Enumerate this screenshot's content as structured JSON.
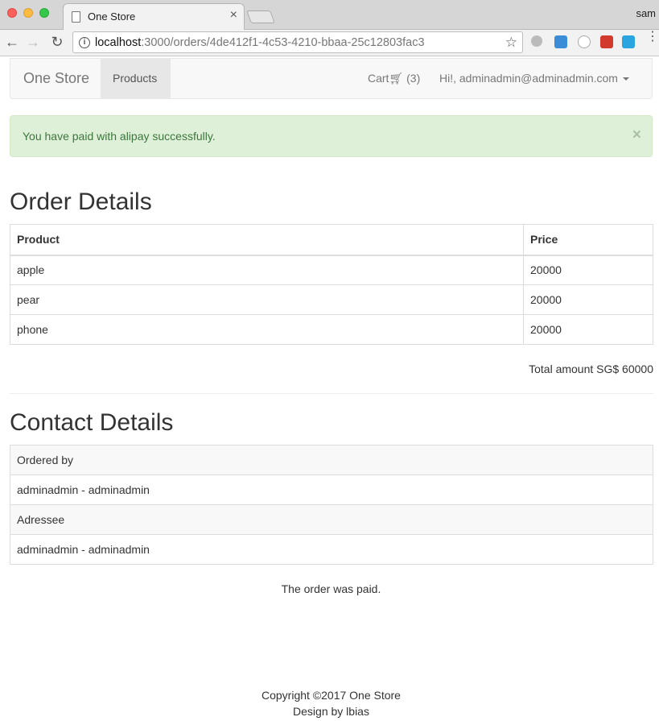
{
  "browser": {
    "tab_title": "One Store",
    "profile": "sam",
    "url_host": "localhost",
    "url_path": ":3000/orders/4de412f1-4c53-4210-bbaa-25c12803fac3"
  },
  "navbar": {
    "brand": "One Store",
    "products": "Products",
    "cart_label": "Cart",
    "cart_count": "(3)",
    "user_greeting": "Hi!, adminadmin@adminadmin.com"
  },
  "alert": {
    "message": "You have paid with alipay successfully.",
    "close": "×"
  },
  "order": {
    "heading": "Order Details",
    "columns": [
      "Product",
      "Price"
    ],
    "rows": [
      {
        "product": "apple",
        "price": "20000"
      },
      {
        "product": "pear",
        "price": "20000"
      },
      {
        "product": "phone",
        "price": "20000"
      }
    ],
    "total": "Total amount SG$ 60000"
  },
  "contact": {
    "heading": "Contact Details",
    "ordered_by_label": "Ordered by",
    "ordered_by_value": "adminadmin - adminadmin",
    "addressee_label": "Adressee",
    "addressee_value": "adminadmin - adminadmin"
  },
  "status": "The order was paid.",
  "footer": {
    "copyright": "Copyright ©2017 One Store",
    "design": "Design by lbias"
  }
}
